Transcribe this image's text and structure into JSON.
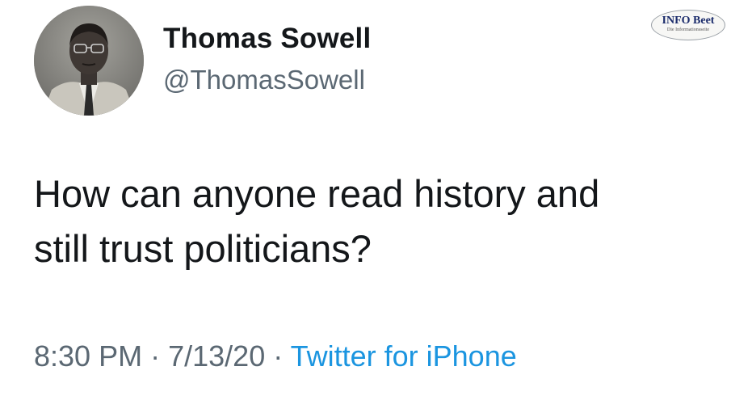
{
  "author": {
    "display_name": "Thomas Sowell",
    "handle": "@ThomasSowell",
    "avatar_icon": "profile-photo"
  },
  "tweet": {
    "text_lines": [
      "How can anyone read history and",
      "still trust politicians?"
    ]
  },
  "meta": {
    "time": "8:30 PM",
    "separator": "·",
    "date": "7/13/20",
    "source": "Twitter for iPhone"
  },
  "watermark": {
    "title": "INFO Beet",
    "subtitle": "Die Informationsseite"
  },
  "colors": {
    "text": "#14171a",
    "secondary": "#5b6873",
    "link": "#1b95e0"
  }
}
